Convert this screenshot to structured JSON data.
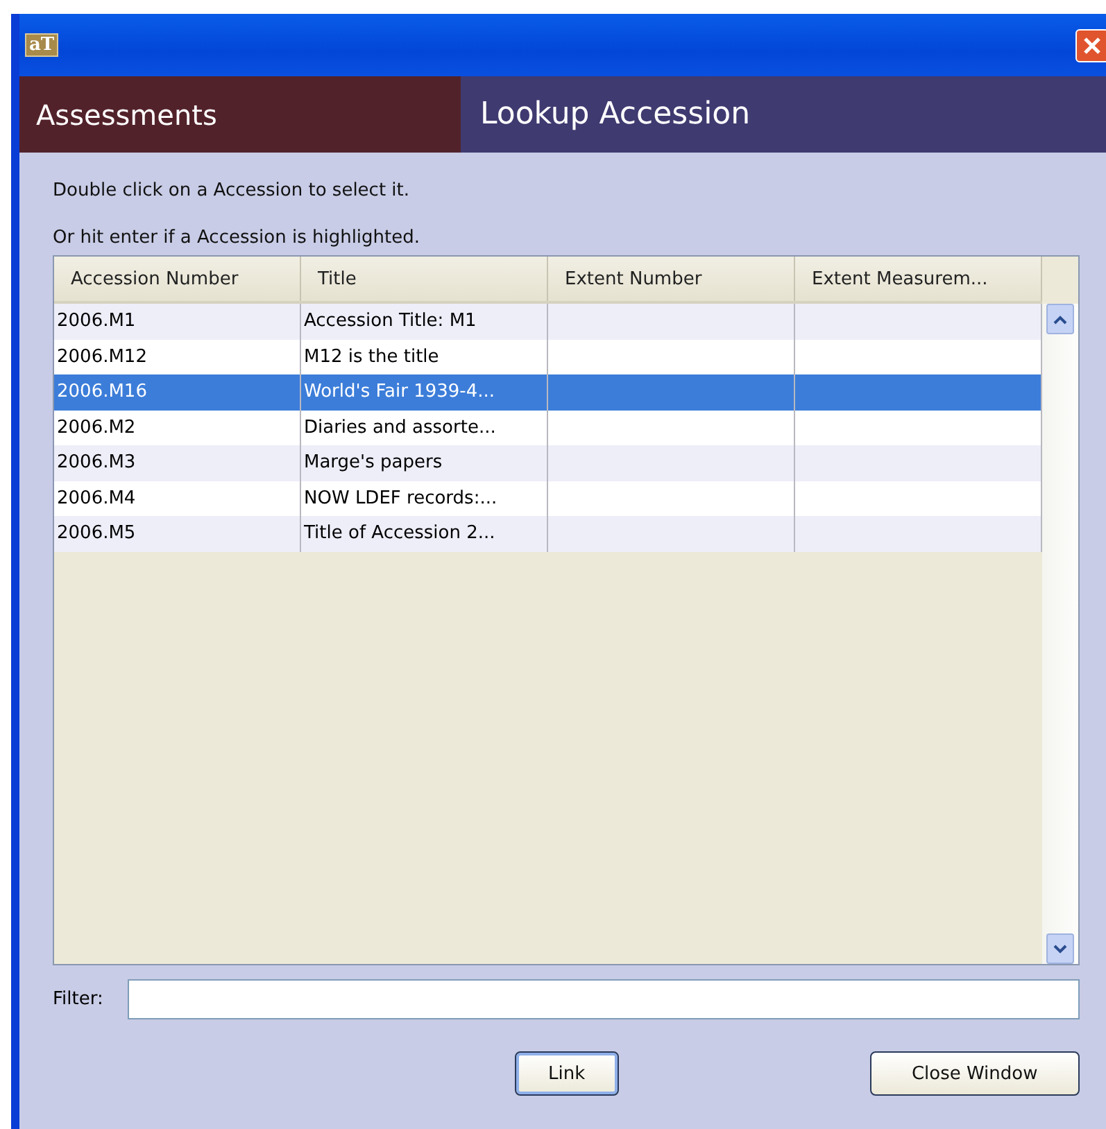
{
  "window": {
    "title_icon": "aT"
  },
  "header": [
    {
      "label": "Assessments",
      "kind": "module"
    },
    {
      "label": "Lookup Accession",
      "kind": "screen"
    }
  ],
  "instructions": [
    "Double click on a Accession to select it.",
    "Or hit enter if a Accession is highlighted."
  ],
  "table": {
    "columns": [
      "Accession Number",
      "Title",
      "Extent Number",
      "Extent Measurem..."
    ],
    "rows": [
      {
        "cells": [
          "2006.M1",
          "Accession Title: M1",
          "",
          ""
        ],
        "selected": false
      },
      {
        "cells": [
          "2006.M12",
          "M12 is the title",
          "",
          ""
        ],
        "selected": false
      },
      {
        "cells": [
          "2006.M16",
          "World's Fair 1939-4...",
          "",
          ""
        ],
        "selected": true
      },
      {
        "cells": [
          "2006.M2",
          "Diaries and assorte...",
          "",
          ""
        ],
        "selected": false
      },
      {
        "cells": [
          "2006.M3",
          "Marge's papers",
          "",
          ""
        ],
        "selected": false
      },
      {
        "cells": [
          "2006.M4",
          "NOW LDEF records:...",
          "",
          ""
        ],
        "selected": false
      },
      {
        "cells": [
          "2006.M5",
          "Title of Accession 2...",
          "",
          ""
        ],
        "selected": false
      }
    ]
  },
  "filter": {
    "label": "Filter:"
  },
  "buttons": [
    {
      "label": "Link",
      "kind": "default"
    },
    {
      "label": "Close Window",
      "kind": "normal"
    }
  ]
}
